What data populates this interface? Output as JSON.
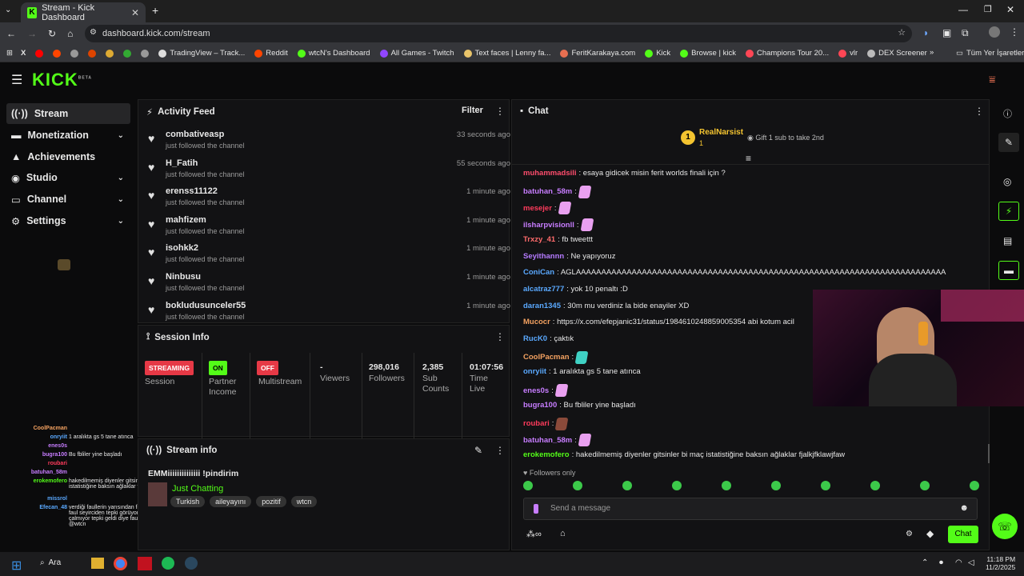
{
  "browser": {
    "tab_title": "Stream - Kick Dashboard",
    "url": "dashboard.kick.com/stream",
    "bookmarks": [
      "TradingView – Track...",
      "Reddit",
      "wtcN's Dashboard",
      "All Games - Twitch",
      "Text faces | Lenny fa...",
      "FeritKarakaya.com",
      "Kick",
      "Browse | kick",
      "Champions Tour 20...",
      "vlr",
      "DEX Screener"
    ],
    "all_bookmarks": "Tüm Yer İşaretleri"
  },
  "brand": {
    "logo": "KICK",
    "beta": "BETA",
    "accent": "#53fc18"
  },
  "sidebar": {
    "items": [
      {
        "label": "Stream"
      },
      {
        "label": "Monetization"
      },
      {
        "label": "Achievements"
      },
      {
        "label": "Studio"
      },
      {
        "label": "Channel"
      },
      {
        "label": "Settings"
      }
    ]
  },
  "activity": {
    "title": "Activity Feed",
    "filter": "Filter",
    "items": [
      {
        "name": "combativeasp",
        "sub": "just followed the channel",
        "time": "33 seconds ago"
      },
      {
        "name": "H_Fatih",
        "sub": "just followed the channel",
        "time": "55 seconds ago"
      },
      {
        "name": "erenss11122",
        "sub": "just followed the channel",
        "time": "1 minute ago"
      },
      {
        "name": "mahfizem",
        "sub": "just followed the channel",
        "time": "1 minute ago"
      },
      {
        "name": "isohkk2",
        "sub": "just followed the channel",
        "time": "1 minute ago"
      },
      {
        "name": "Ninbusu",
        "sub": "just followed the channel",
        "time": "1 minute ago"
      },
      {
        "name": "bokludusunceler55",
        "sub": "just followed the channel",
        "time": "1 minute ago"
      }
    ]
  },
  "session": {
    "title": "Session Info",
    "streaming": "STREAMING",
    "session_label": "Session",
    "on": "ON",
    "partner": "Partner Income",
    "off": "OFF",
    "multistream": "Multistream",
    "viewers_val": "-",
    "viewers": "Viewers",
    "followers_val": "298,016",
    "followers": "Followers",
    "subs_val": "2,385",
    "subs": "Sub Counts",
    "time_val": "01:07:56",
    "time": "Time Live"
  },
  "streaminfo": {
    "title": "Stream info",
    "stream_title": "EMMiiiiiiiiiiiiii !pindirim",
    "category": "Just Chatting",
    "tags": [
      "Turkish",
      "aileyayını",
      "pozitif",
      "wtcn"
    ]
  },
  "chat": {
    "title": "Chat",
    "top_user": "RealNarsist",
    "top_rank": "1",
    "top_count": "1",
    "gift": "Gift 1 sub to take 2nd",
    "followers_only": "Followers only",
    "placeholder": "Send a message",
    "send": "Chat",
    "lines": [
      {
        "user": "muhammadsili",
        "color": "#ff4d6d",
        "msg": ": esaya gidicek misin ferit worlds finali için ?"
      },
      {
        "user": "batuhan_58m",
        "color": "#c77dff",
        "msg": ":"
      },
      {
        "user": "mesejer",
        "color": "#ff3b5c",
        "msg": ":"
      },
      {
        "user": "ilsharpvisionll",
        "color": "#c77dff",
        "msg": ":"
      },
      {
        "user": "Trxzy_41",
        "color": "#ff6b6b",
        "msg": ": fb tweettt"
      },
      {
        "user": "Seyithannn",
        "color": "#b57bff",
        "msg": ": Ne yapıyoruz"
      },
      {
        "user": "ConiCan",
        "color": "#5aa9ff",
        "msg": ": AGLAAAAAAAAAAAAAAAAAAAAAAAAAAAAAAAAAAAAAAAAAAAAAAAAAAAAAAAAAAAAAAAAAAAAAAAAA"
      },
      {
        "user": "alcatraz777",
        "color": "#5aa9ff",
        "msg": ": yok 10 penaltı :D"
      },
      {
        "user": "daran1345",
        "color": "#5aa9ff",
        "msg": ": 30m mu verdiniz la bide enayiler XD"
      },
      {
        "user": "Mucocr",
        "color": "#f4a261",
        "msg": ": https://x.com/efepjanic31/status/1984610248859005354 abi kotum acil"
      },
      {
        "user": "RucK0",
        "color": "#5aa9ff",
        "msg": ": çaktık"
      },
      {
        "user": "CoolPacman",
        "color": "#f4a261",
        "msg": ":"
      },
      {
        "user": "onryiit",
        "color": "#5aa9ff",
        "msg": ": 1 aralıkta gs 5 tane atınca"
      },
      {
        "user": "enes0s",
        "color": "#c77dff",
        "msg": ":"
      },
      {
        "user": "bugra100",
        "color": "#c77dff",
        "msg": ": Bu fbliler yine başladı"
      },
      {
        "user": "roubari",
        "color": "#ff3b5c",
        "msg": ":"
      },
      {
        "user": "batuhan_58m",
        "color": "#c77dff",
        "msg": ":"
      },
      {
        "user": "erokemofero",
        "color": "#53fc18",
        "msg": ": hakedilmemiş diyenler gitsinler bi maç istatistiğine baksın ağlaklar fjalkjfklawjfaw"
      }
    ]
  },
  "overlay": {
    "lines": [
      {
        "user": "CoolPacman",
        "color": "#f4a261",
        "msg": ""
      },
      {
        "user": "onryiit",
        "color": "#5aa9ff",
        "msg": "1 aralıkta gs 5 tane atınca"
      },
      {
        "user": "enes0s",
        "color": "#c77dff",
        "msg": ""
      },
      {
        "user": "bugra100",
        "color": "#c77dff",
        "msg": "Bu fbliler yine başladı"
      },
      {
        "user": "roubari",
        "color": "#ff3b5c",
        "msg": ""
      },
      {
        "user": "batuhan_58m",
        "color": "#c77dff",
        "msg": ""
      },
      {
        "user": "erokemofero",
        "color": "#53fc18",
        "msg": "hakedilmemiş diyenler gitsinler bi maç istatistiğine baksın ağlaklar fjalkjfklawjfaw"
      },
      {
        "user": "missrol",
        "color": "#5aa9ff",
        "msg": ""
      },
      {
        "user": "Efecan_48",
        "color": "#5aa9ff",
        "msg": "verdiği faullerin yarısından fazlası tepkiye faul seyirciden tepki görüyor ilk başta çalmıyor tepki geldi diye faulü veriyor @wtcn"
      }
    ]
  },
  "taskbar": {
    "search": "Ara",
    "time": "11:18 PM",
    "date": "11/2/2025"
  }
}
